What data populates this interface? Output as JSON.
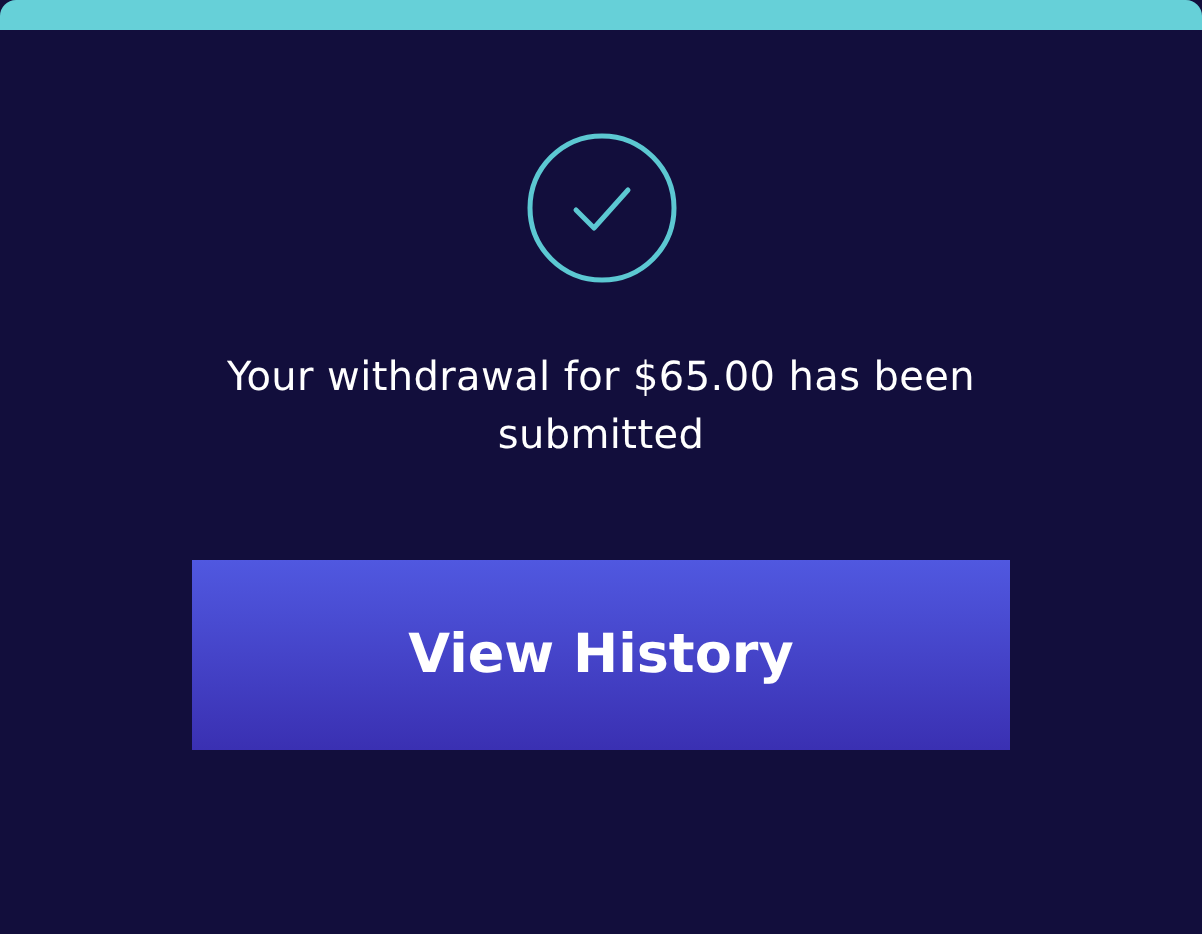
{
  "message": "Your withdrawal for $65.00 has been submitted",
  "button": {
    "label": "View History"
  }
}
